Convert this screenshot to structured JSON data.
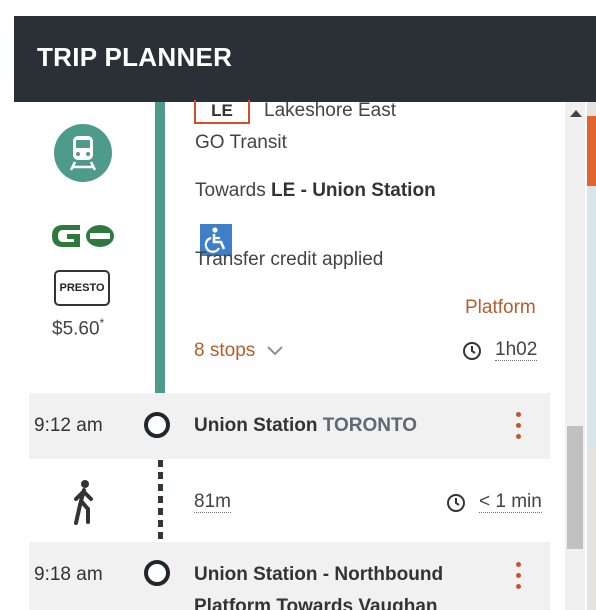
{
  "header": {
    "title": "TRIP PLANNER"
  },
  "leg": {
    "line_code": "LE",
    "line_name": "Lakeshore East",
    "agency": "GO Transit",
    "towards_prefix": "Towards",
    "towards_dest": "LE - Union Station",
    "transfer_note": "Transfer credit applied",
    "platform_label": "Platform",
    "stops_label": "8 stops",
    "duration": "1h02",
    "fare": "$5.60",
    "fare_mark": "*",
    "presto_label": "PRESTO",
    "icons": {
      "mode": "train-icon",
      "agency_logo": "go-logo-icon",
      "accessible": "wheelchair-icon",
      "clock": "clock-icon",
      "chevron": "chevron-down-icon"
    },
    "line_color": "#4e9b8c",
    "badge_color": "#cf4f2d"
  },
  "stops": [
    {
      "time": "9:12 am",
      "name": "Union Station",
      "city": "TORONTO"
    },
    {
      "time": "9:18 am",
      "name_line1": "Union Station - Northbound",
      "name_line2": "Platform Towards Vaughan"
    }
  ],
  "walk": {
    "distance": "81m",
    "duration": "< 1 min",
    "icon": "walking-person-icon"
  },
  "colors": {
    "header_bg": "#2a3035",
    "accent": "#b45d2e",
    "red_line": "#d9434a"
  }
}
